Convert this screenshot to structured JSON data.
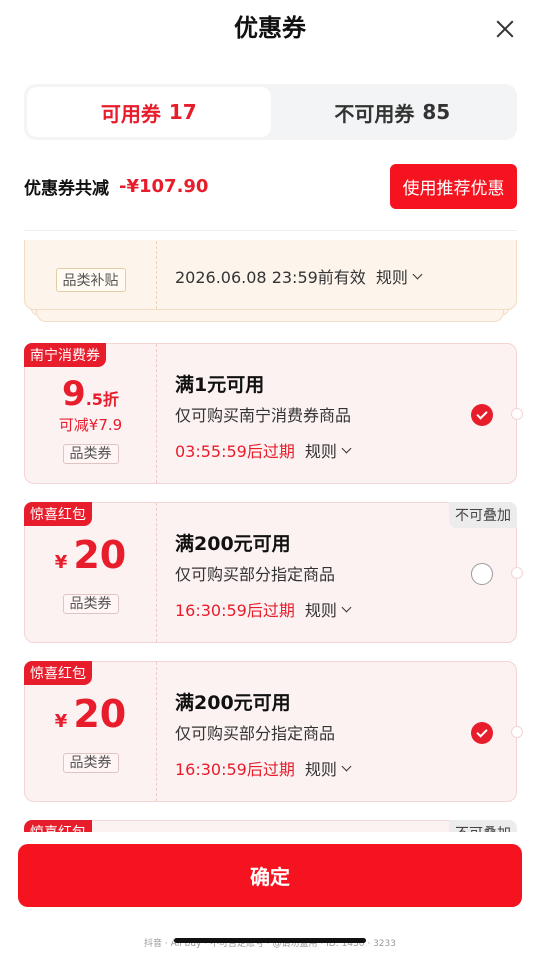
{
  "title": "优惠券",
  "tabs": [
    {
      "label": "可用券",
      "count": "17"
    },
    {
      "label": "不可用券",
      "count": "85"
    }
  ],
  "summary": {
    "label": "优惠券共减",
    "amount": "-¥107.90",
    "recommend_button": "使用推荐优惠"
  },
  "coupons": [
    {
      "category": "品类补贴",
      "expire": "2026.06.08 23:59前有效",
      "rule": "规则",
      "selected": true
    },
    {
      "tag": "南宁消费券",
      "discount_big": "9",
      "discount_small": ".5折",
      "reduce": "可减¥7.9",
      "category": "品类券",
      "condition": "满1元可用",
      "desc": "仅可购买南宁消费券商品",
      "expire": "03:55:59后过期",
      "rule": "规则",
      "selected": true
    },
    {
      "tag": "惊喜红包",
      "badge": "不可叠加",
      "yen": "¥",
      "amount": "20",
      "category": "品类券",
      "condition": "满200元可用",
      "desc": "仅可购买部分指定商品",
      "expire": "16:30:59后过期",
      "rule": "规则",
      "selected": false
    },
    {
      "tag": "惊喜红包",
      "yen": "¥",
      "amount": "20",
      "category": "品类券",
      "condition": "满200元可用",
      "desc": "仅可购买部分指定商品",
      "expire": "16:30:59后过期",
      "rule": "规则",
      "selected": true
    },
    {
      "tag": "惊喜红包",
      "badge": "不可叠加"
    }
  ],
  "confirm": "确定",
  "footer": "抖音 · All buy · 不可否定账号 · @请勿盗用 · ID: 1430 · 3233"
}
